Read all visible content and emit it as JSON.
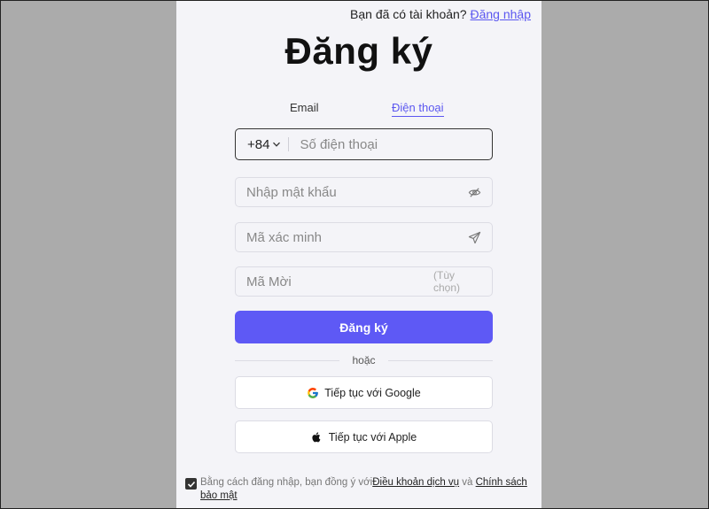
{
  "header": {
    "have_account": "Bạn đã có tài khoản?",
    "login_link": "Đăng nhập"
  },
  "title": "Đăng ký",
  "tabs": [
    {
      "label": "Email",
      "active": false
    },
    {
      "label": "Điện thoại",
      "active": true
    }
  ],
  "form": {
    "country_code": "+84",
    "phone_placeholder": "Số điện thoại",
    "password_placeholder": "Nhập mật khẩu",
    "code_placeholder": "Mã xác minh",
    "invite_placeholder": "Mã Mời",
    "invite_optional": "(Tùy chọn)",
    "submit_label": "Đăng ký"
  },
  "divider_text": "hoặc",
  "social": {
    "google_label": "Tiếp tục với Google",
    "apple_label": "Tiếp tục với Apple"
  },
  "terms": {
    "prefix": "Bằng cách đăng nhập, bạn đồng ý với",
    "terms_link": "Điều khoản dịch vụ",
    "and": " và ",
    "privacy_link": "Chính sách bảo mật",
    "checked": true
  },
  "colors": {
    "accent": "#5e59f5",
    "link": "#5b57f0",
    "background": "#ababab",
    "panel": "#f4f4f8"
  },
  "icons": [
    "chevron-down-icon",
    "eye-off-icon",
    "send-icon",
    "google-icon",
    "apple-icon",
    "check-icon"
  ]
}
